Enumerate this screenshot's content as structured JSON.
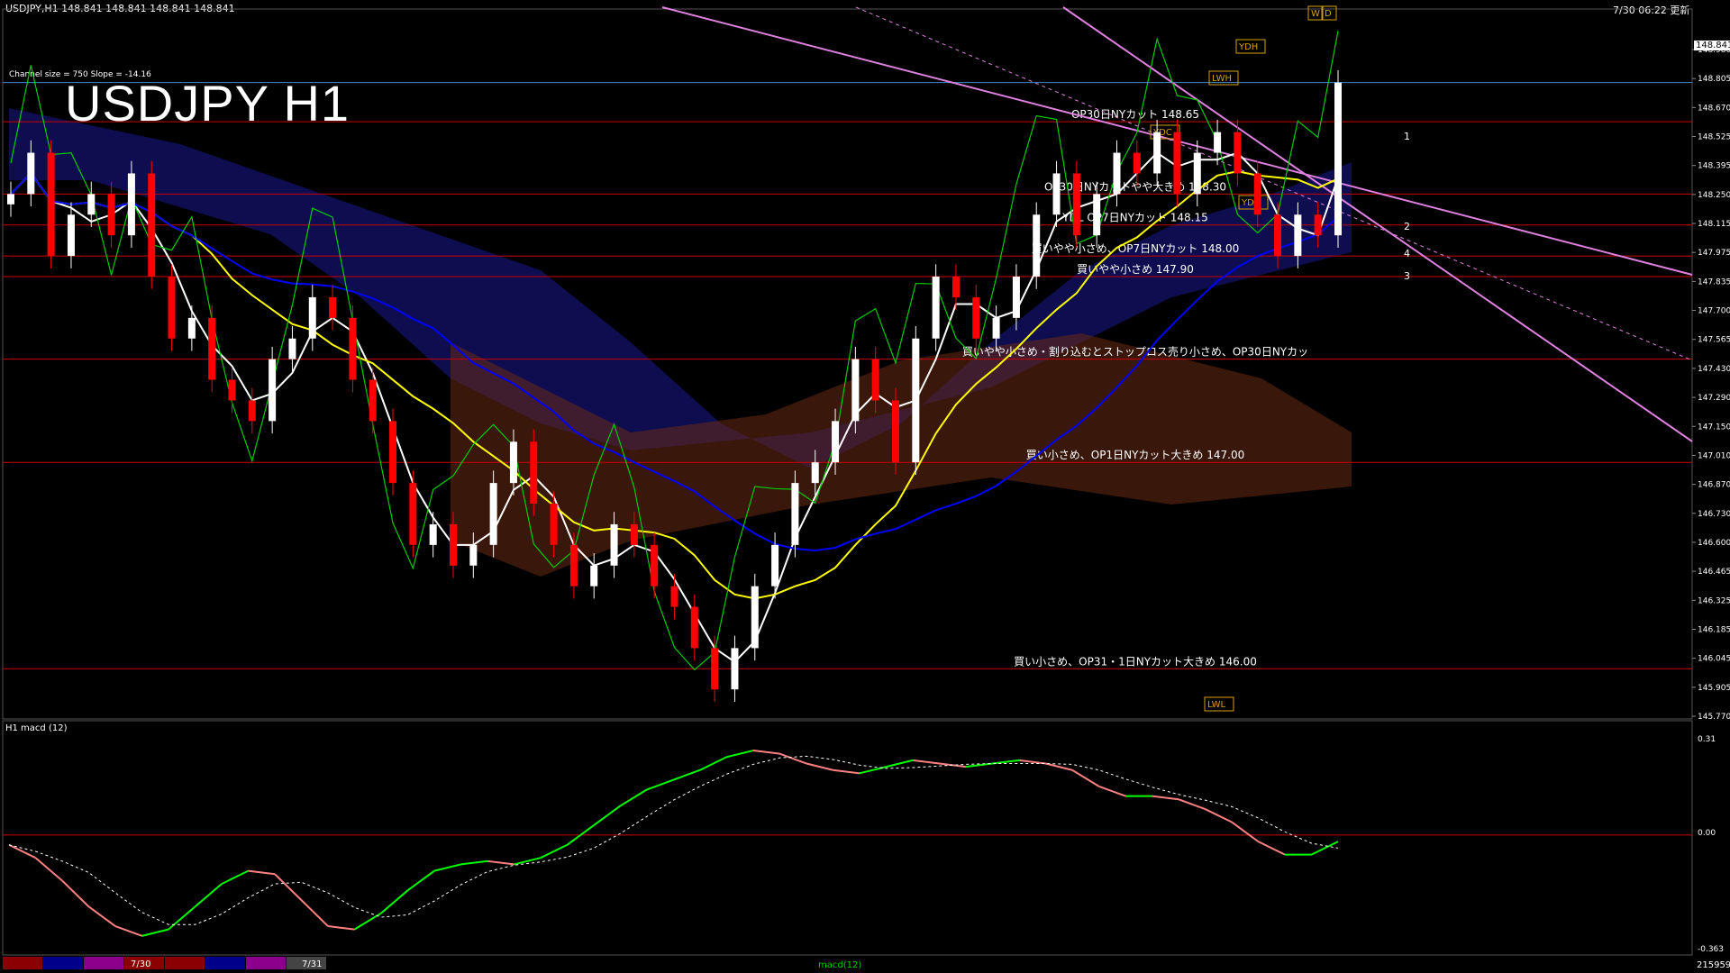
{
  "chart_data": {
    "type": "candlestick",
    "title": "USDJPY H1",
    "header_info": "USDJPY,H1  148.841 148.841 148.841 148.841",
    "updated": "7/30 06:22 更新",
    "channel_info": "Channel size = 750 Slope = -14.16",
    "ylim": [
      145.77,
      149.0
    ],
    "current_price": "148.841",
    "y_ticks": [
      "148.980",
      "148.805",
      "148.670",
      "148.525",
      "148.395",
      "148.250",
      "148.115",
      "147.975",
      "147.835",
      "147.700",
      "147.565",
      "147.430",
      "147.290",
      "147.150",
      "147.010",
      "146.870",
      "146.730",
      "146.600",
      "146.465",
      "146.325",
      "146.185",
      "146.045",
      "145.905",
      "145.770"
    ],
    "x_labels": [
      "7/30",
      "7/31"
    ],
    "candles": [
      148.3,
      148.5,
      148.0,
      148.2,
      148.3,
      148.1,
      148.4,
      147.9,
      147.6,
      147.7,
      147.4,
      147.3,
      147.2,
      147.5,
      147.6,
      147.8,
      147.7,
      147.4,
      147.2,
      146.9,
      146.6,
      146.7,
      146.5,
      146.6,
      146.9,
      147.1,
      146.8,
      146.6,
      146.4,
      146.5,
      146.7,
      146.6,
      146.4,
      146.3,
      146.1,
      145.9,
      146.1,
      146.4,
      146.6,
      146.9,
      147.0,
      147.2,
      147.5,
      147.3,
      147.0,
      147.6,
      147.9,
      147.8,
      147.6,
      147.7,
      147.9,
      148.2,
      148.4,
      148.1,
      148.3,
      148.5,
      148.4,
      148.6,
      148.3,
      148.5,
      148.6,
      148.4,
      148.2,
      148.0,
      148.2,
      148.1,
      148.84
    ],
    "levels": [
      {
        "price": 148.65,
        "label": "OP30日NYカット 148.65"
      },
      {
        "price": 148.3,
        "label": "OP30日NYカットやや大きめ 148.30"
      },
      {
        "price": 148.15,
        "label": "YDL OP7日NYカット 148.15"
      },
      {
        "price": 148.0,
        "label": "買いやや小さめ、OP7日NYカット 148.00"
      },
      {
        "price": 147.9,
        "label": "買いやや小さめ 147.90"
      },
      {
        "price": 147.5,
        "label": "買いやや小さめ・割り込むとストップロス売り小さめ、OP30日NYカッ"
      },
      {
        "price": 147.0,
        "label": "買い小さめ、OP1日NYカット大きめ 147.00"
      },
      {
        "price": 146.0,
        "label": "買い小さめ、OP31・1日NYカット大きめ 146.00"
      }
    ],
    "box_labels": [
      "YDH",
      "YDC",
      "YDL",
      "LWH",
      "LWL",
      "W",
      "D"
    ],
    "channel_labels": [
      "1",
      "2",
      "3",
      "4"
    ],
    "macd": {
      "title": "H1  macd (12)",
      "y_ticks": [
        "0.31",
        "0.00",
        "-0.363"
      ],
      "zero": 0.0,
      "ylim": [
        -0.363,
        0.31
      ],
      "values": [
        -0.03,
        -0.07,
        -0.14,
        -0.22,
        -0.28,
        -0.31,
        -0.29,
        -0.22,
        -0.15,
        -0.11,
        -0.12,
        -0.2,
        -0.28,
        -0.29,
        -0.24,
        -0.17,
        -0.11,
        -0.09,
        -0.08,
        -0.09,
        -0.07,
        -0.03,
        0.03,
        0.09,
        0.14,
        0.17,
        0.2,
        0.24,
        0.26,
        0.25,
        0.22,
        0.2,
        0.19,
        0.21,
        0.23,
        0.22,
        0.21,
        0.22,
        0.23,
        0.22,
        0.2,
        0.15,
        0.12,
        0.12,
        0.11,
        0.08,
        0.04,
        -0.02,
        -0.06,
        -0.06,
        -0.02
      ],
      "bottom_tag": "macd(12)"
    }
  },
  "colors": {
    "bull": "#ffffff",
    "bear": "#ff0000",
    "ma_white": "#ffffff",
    "ma_yellow": "#ffff00",
    "ma_blue": "#0000ff",
    "green": "#00cc00",
    "channel": "#e080e0",
    "macd_up": "#00ff00",
    "macd_down": "#ff8080"
  },
  "bottom_bar": {
    "right_text": "215959"
  }
}
